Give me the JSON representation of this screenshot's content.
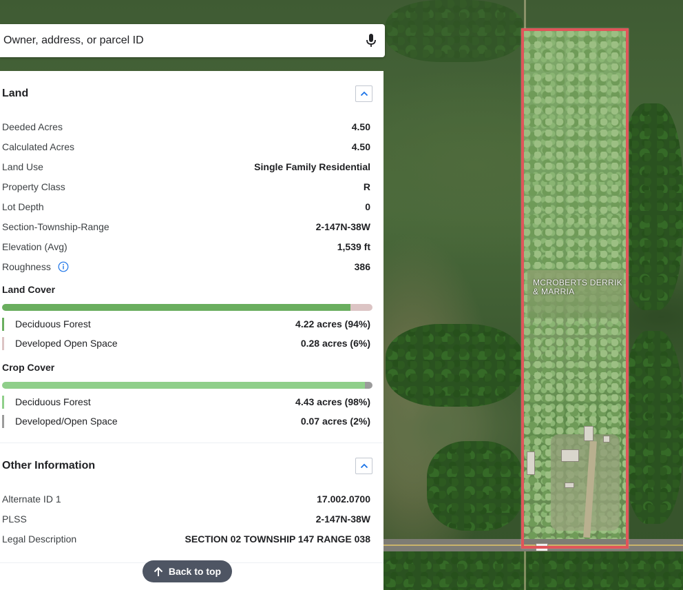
{
  "search": {
    "placeholder": "Owner, address, or parcel ID",
    "mic_icon": "microphone-icon"
  },
  "map": {
    "parcel_label": "MCROBERTS DERRIK & MARRIA",
    "parcel_outline_color": "#e0555a"
  },
  "land": {
    "title": "Land",
    "rows": [
      {
        "label": "Deeded Acres",
        "value": "4.50"
      },
      {
        "label": "Calculated Acres",
        "value": "4.50"
      },
      {
        "label": "Land Use",
        "value": "Single Family Residential"
      },
      {
        "label": "Property Class",
        "value": "R"
      },
      {
        "label": "Lot Depth",
        "value": "0"
      },
      {
        "label": "Section-Township-Range",
        "value": "2-147N-38W"
      },
      {
        "label": "Elevation (Avg)",
        "value": "1,539 ft"
      },
      {
        "label": "Roughness",
        "value": "386"
      }
    ],
    "land_cover": {
      "title": "Land Cover",
      "items": [
        {
          "label": "Deciduous Forest",
          "value": "4.22 acres (94%)",
          "percent": 94,
          "color": "#6aae5f"
        },
        {
          "label": "Developed Open Space",
          "value": "0.28 acres (6%)",
          "percent": 6,
          "color": "#dcc4c4"
        }
      ]
    },
    "crop_cover": {
      "title": "Crop Cover",
      "items": [
        {
          "label": "Deciduous Forest",
          "value": "4.43 acres (98%)",
          "percent": 98,
          "color": "#8fcf8a"
        },
        {
          "label": "Developed/Open Space",
          "value": "0.07 acres (2%)",
          "percent": 2,
          "color": "#9b9b9b"
        }
      ]
    }
  },
  "other": {
    "title": "Other Information",
    "rows": [
      {
        "label": "Alternate ID 1",
        "value": "17.002.0700"
      },
      {
        "label": "PLSS",
        "value": "2-147N-38W"
      },
      {
        "label": "Legal Description",
        "value": "SECTION 02 TOWNSHIP 147 RANGE 038"
      }
    ]
  },
  "back_to_top": "Back to top"
}
